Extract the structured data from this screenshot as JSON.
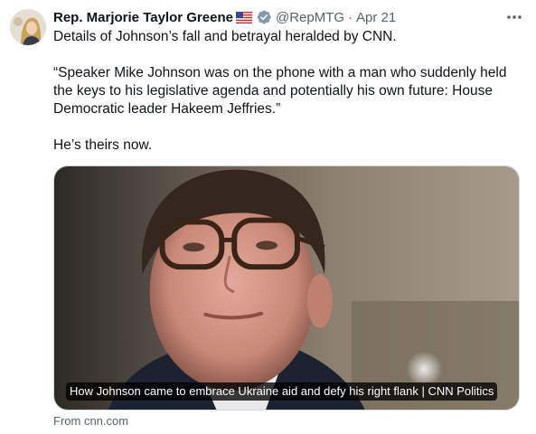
{
  "author": {
    "name": "Rep. Marjorie Taylor Greene",
    "flag_icon": "us-flag-icon",
    "verified_icon": "verified-badge-icon",
    "handle": "@RepMTG",
    "separator": "·",
    "date": "Apr 21"
  },
  "tweet": {
    "line1": "Details of Johnson’s fall and betrayal heralded by CNN.",
    "quote": "“Speaker Mike Johnson was on the phone with a man who suddenly held the keys to his legislative agenda and potentially his own future: House Democratic leader Hakeem Jeffries.”",
    "line3": "He’s theirs now."
  },
  "card": {
    "caption": "How Johnson came to embrace Ukraine aid and defy his right flank | CNN Politics",
    "source": "From cnn.com"
  },
  "colors": {
    "text": "#0f1419",
    "secondary": "#536471",
    "verified": "#829aab",
    "border": "#cfd9de"
  }
}
